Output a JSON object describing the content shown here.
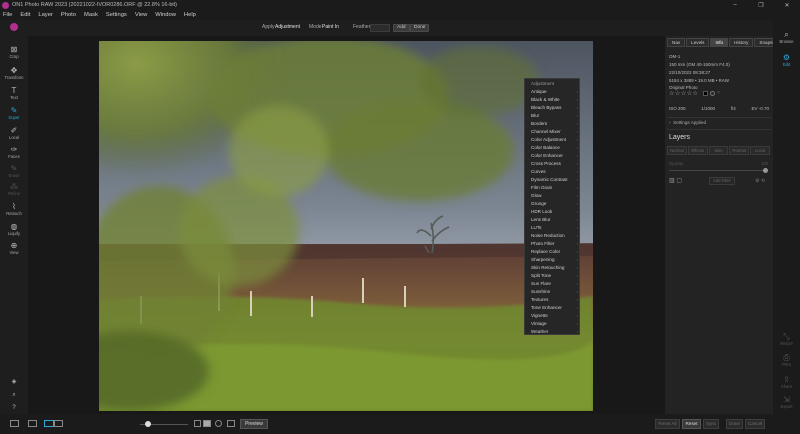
{
  "window": {
    "title": "ON1 Photo RAW 2023 (20221022-IVOR0286.ORF @ 22.8% 16-bit)",
    "controls": [
      "–",
      "❐",
      "✕"
    ]
  },
  "menu": [
    "File",
    "Edit",
    "Layer",
    "Photo",
    "Mask",
    "Settings",
    "View",
    "Window",
    "Help"
  ],
  "options": {
    "apply_label": "Apply",
    "apply_value": "Adjustment",
    "mode_label": "Mode",
    "mode_value": "Paint In",
    "feather_label": "Feather",
    "add_label": "Add",
    "done_label": "Done"
  },
  "tools": [
    {
      "label": "Crop",
      "icon": "crop-icon",
      "glyph": "⊠"
    },
    {
      "label": "Transform",
      "icon": "move-icon",
      "glyph": "✥"
    },
    {
      "label": "Text",
      "icon": "text-icon",
      "glyph": "T"
    },
    {
      "label": "Super",
      "icon": "brush-icon",
      "glyph": "✎"
    },
    {
      "label": "Local",
      "icon": "local-brush-icon",
      "glyph": "✐"
    },
    {
      "label": "Faces",
      "icon": "face-icon",
      "glyph": "✑"
    },
    {
      "label": "Erase",
      "icon": "eraser-icon",
      "glyph": "✎"
    },
    {
      "label": "Refine",
      "icon": "refine-icon",
      "glyph": "⁂"
    },
    {
      "label": "Retouch",
      "icon": "retouch-icon",
      "glyph": "⌇"
    },
    {
      "label": "Liquify",
      "icon": "liquify-icon",
      "glyph": "◍"
    },
    {
      "label": "View",
      "icon": "zoom-icon",
      "glyph": "⊕"
    }
  ],
  "filter_menu": {
    "header": "Adjustment",
    "items": [
      "Antique",
      "Black & White",
      "Bleach Bypass",
      "Blur",
      "Borders",
      "Channel Mixer",
      "Color Adjustment",
      "Color Balance",
      "Color Enhancer",
      "Cross Process",
      "Curves",
      "Dynamic Contrast",
      "Film Grain",
      "Glow",
      "Grunge",
      "HDR Look",
      "Lens Blur",
      "LUTs",
      "Noise Reduction",
      "Photo Filter",
      "Replace Color",
      "Sharpening",
      "Skin Retouching",
      "Split Tone",
      "Sun Flare",
      "Sunshine",
      "Textures",
      "Tone Enhancer",
      "Vignette",
      "Vintage",
      "Weather"
    ]
  },
  "panel": {
    "tabs": [
      "Nav",
      "Levels",
      "Info",
      "History",
      "Snapshots"
    ],
    "active_tab": 2,
    "camera": "OM-1",
    "lens": "150 mm (OM 40-150mm F4.0)",
    "date": "22/10/2022 08:38:27",
    "dims": "5184 x 3888 • 19.0 MB • RAW",
    "original": "Original Photo",
    "rating": "☆☆☆☆☆",
    "iso": "ISO 200",
    "shutter": "1/1000",
    "aperture": "f/4",
    "ev": "EV -0.70",
    "settings_applied": "Settings Applied",
    "layers_title": "Layers",
    "blend_buttons": [
      "Normal",
      "Effects",
      "Skin",
      "Portrait",
      "Local"
    ],
    "opacity_label": "Opacity",
    "opacity_value": "100",
    "add_filter": "Add Filter"
  },
  "modules": [
    {
      "label": "Browse",
      "icon": "browse-icon",
      "glyph": "⌕"
    },
    {
      "label": "Edit",
      "icon": "edit-icon",
      "glyph": "⚙"
    },
    {
      "label": "Resize",
      "icon": "resize-icon",
      "glyph": "⤡"
    },
    {
      "label": "Print",
      "icon": "print-icon",
      "glyph": "⎙"
    },
    {
      "label": "Share",
      "icon": "share-icon",
      "glyph": "⇪"
    },
    {
      "label": "Export",
      "icon": "export-icon",
      "glyph": "⇲"
    }
  ],
  "bottom": {
    "preview_label": "Preview",
    "reset_all": "Reset All",
    "reset": "Reset",
    "sync": "Sync",
    "done": "Done",
    "cancel": "Cancel"
  },
  "colors": {
    "accent": "#2da8d8",
    "logo": "#b03090"
  }
}
